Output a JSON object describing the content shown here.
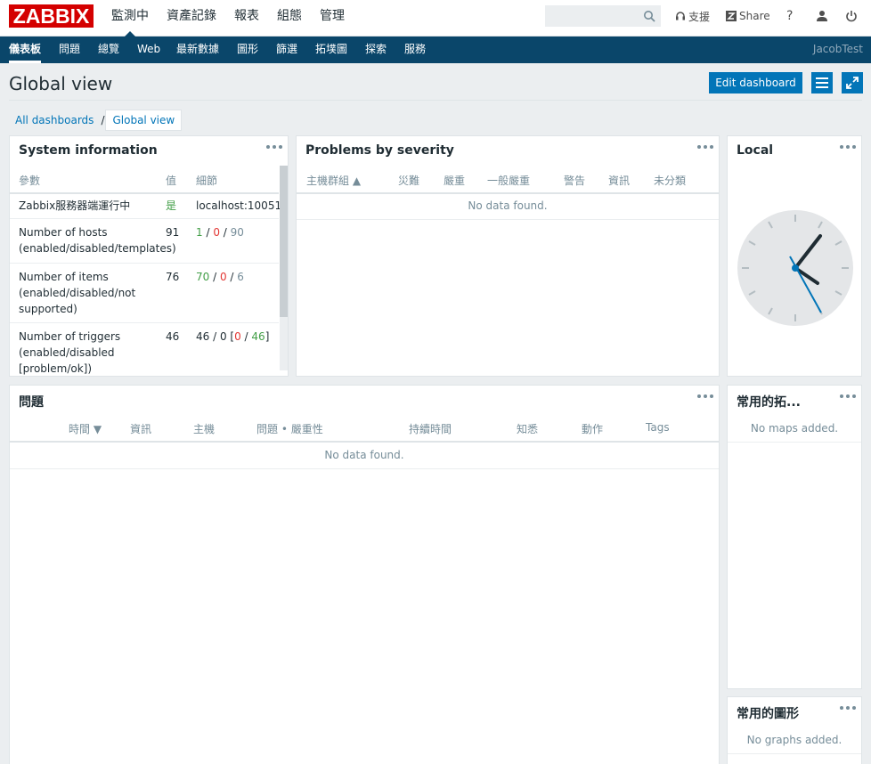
{
  "logo": "ZABBIX",
  "main_nav": [
    "監測中",
    "資產記錄",
    "報表",
    "組態",
    "管理"
  ],
  "search": {
    "placeholder": ""
  },
  "top_actions": {
    "support": "支援",
    "share": "Share",
    "help": "?"
  },
  "sub_nav": [
    "儀表板",
    "問題",
    "總覽",
    "Web",
    "最新數據",
    "圖形",
    "篩選",
    "拓墣圖",
    "探索",
    "服務"
  ],
  "user": "JacobTest",
  "page_title": "Global view",
  "edit_button": "Edit dashboard",
  "breadcrumb": {
    "all": "All dashboards",
    "sep": "/",
    "current": "Global view"
  },
  "widgets": {
    "system_info": {
      "title": "System information",
      "headers": [
        "參數",
        "值",
        "細節"
      ],
      "rows": [
        {
          "param": "Zabbix服務器端運行中",
          "value": "是",
          "detail": "localhost:10051"
        },
        {
          "param": "Number of hosts (enabled/disabled/templates)",
          "value": "91",
          "d1": "1",
          "d2": "0",
          "d3": "90"
        },
        {
          "param": "Number of items (enabled/disabled/not supported)",
          "value": "76",
          "d1": "70",
          "d2": "0",
          "d3": "6"
        },
        {
          "param": "Number of triggers (enabled/disabled [problem/ok])",
          "value": "46",
          "d1": "46",
          "d2": "0",
          "d3": "0",
          "d4": "46"
        }
      ]
    },
    "problems_by_severity": {
      "title": "Problems by severity",
      "headers": [
        "主機群組 ▲",
        "災難",
        "嚴重",
        "一般嚴重",
        "警告",
        "資訊",
        "未分類"
      ],
      "empty": "No data found."
    },
    "clock": {
      "title": "Local"
    },
    "problems": {
      "title": "問題",
      "headers": [
        "時間 ▼",
        "資訊",
        "主機",
        "問題 • 嚴重性",
        "持續時間",
        "知悉",
        "動作",
        "Tags"
      ],
      "empty": "No data found."
    },
    "fav_maps": {
      "title": "常用的拓...",
      "empty": "No maps added."
    },
    "fav_graphs": {
      "title": "常用的圖形",
      "empty": "No graphs added."
    }
  },
  "colors": {
    "header_blue": "#0a466a",
    "button_blue": "#0275b8",
    "logo_red": "#d40000",
    "ok_green": "#429e47",
    "problem_red": "#e33734"
  }
}
